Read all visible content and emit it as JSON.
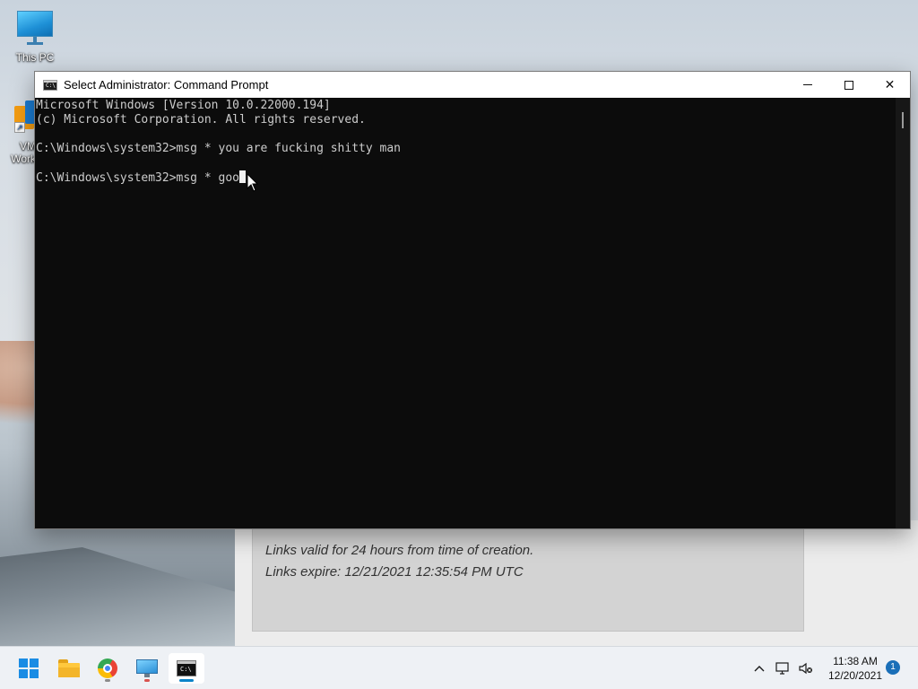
{
  "desktop": {
    "icons": [
      {
        "label": "This PC"
      },
      {
        "label": "VMware Workstation"
      }
    ],
    "icon_label_visible_vm": "VM\nWork"
  },
  "web_page": {
    "lines": [
      "Links valid for 24 hours from time of creation.",
      "Links expire: 12/21/2021 12:35:54 PM UTC"
    ]
  },
  "cmd_window": {
    "title": "Select Administrator: Command Prompt",
    "icon_text": "C:\\",
    "controls": {
      "minimize": "minimize",
      "maximize": "maximize",
      "close": "✕"
    },
    "lines": [
      "Microsoft Windows [Version 10.0.22000.194]",
      "(c) Microsoft Corporation. All rights reserved.",
      "",
      "C:\\Windows\\system32>msg * you are fucking shitty man",
      "",
      "C:\\Windows\\system32>msg * goo"
    ],
    "cursor_line_index": 5
  },
  "taskbar": {
    "apps": [
      {
        "name": "start",
        "icon": "windows-logo-icon"
      },
      {
        "name": "file-explorer",
        "icon": "folder-icon"
      },
      {
        "name": "chrome",
        "icon": "chrome-icon"
      },
      {
        "name": "remote-desktop",
        "icon": "remote-desktop-icon"
      },
      {
        "name": "command-prompt",
        "icon": "command-prompt-icon",
        "active": true
      }
    ],
    "tray": {
      "chevron": "∧",
      "time": "11:38 AM",
      "date": "12/20/2021",
      "notifications": "1"
    }
  },
  "colors": {
    "console_bg": "#0c0c0c",
    "console_fg": "#cccccc",
    "accent": "#0a84c9",
    "start_blue": "#1a8ce4"
  }
}
